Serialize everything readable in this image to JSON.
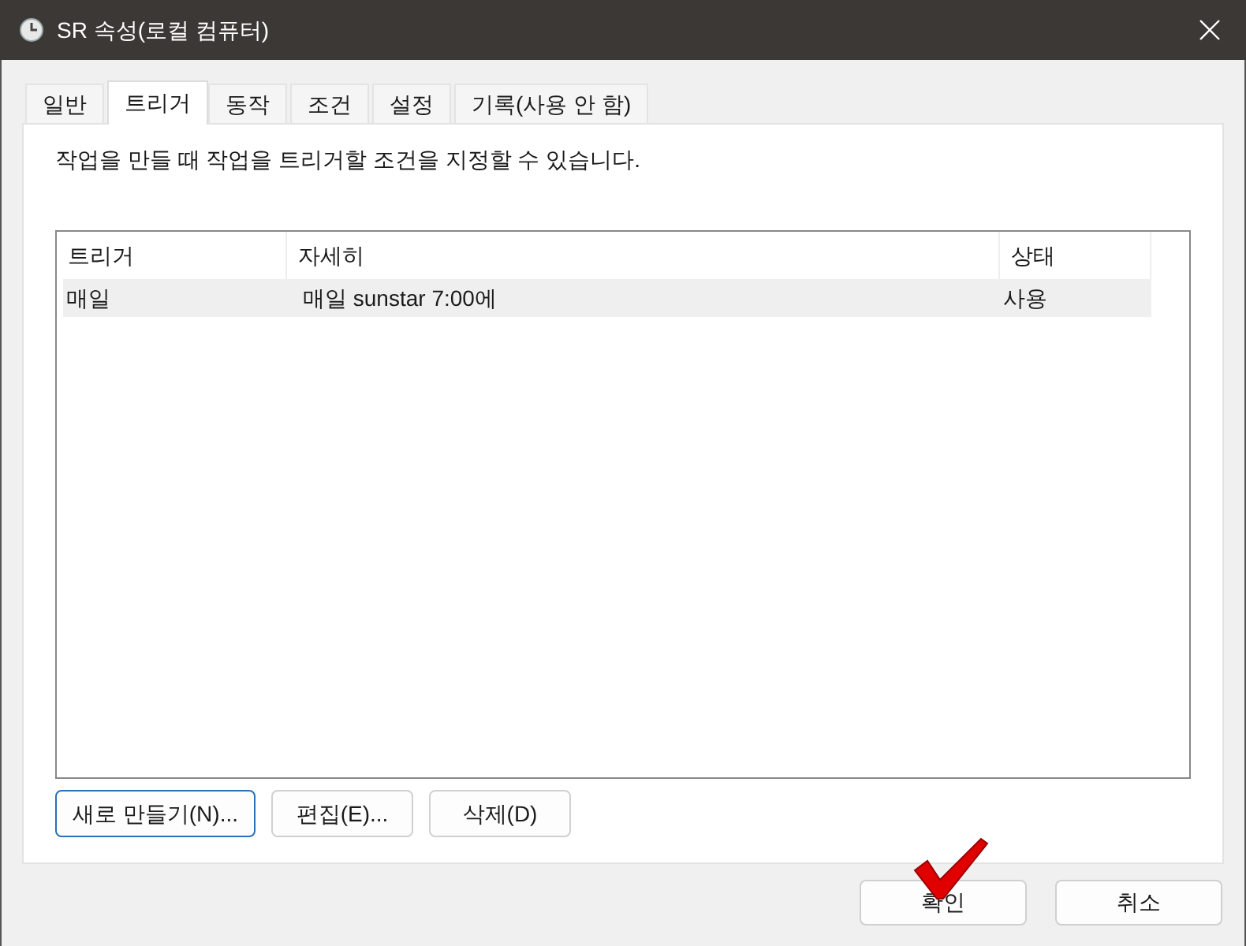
{
  "window": {
    "title": "SR 속성(로컬 컴퓨터)"
  },
  "tabs": [
    {
      "label": "일반",
      "selected": false
    },
    {
      "label": "트리거",
      "selected": true
    },
    {
      "label": "동작",
      "selected": false
    },
    {
      "label": "조건",
      "selected": false
    },
    {
      "label": "설정",
      "selected": false
    },
    {
      "label": "기록(사용 안 함)",
      "selected": false
    }
  ],
  "description": "작업을 만들 때 작업을 트리거할 조건을 지정할 수 있습니다.",
  "table": {
    "columns": [
      "트리거",
      "자세히",
      "상태"
    ],
    "rows": [
      {
        "cells": [
          "매일",
          "매일 sunstar 7:00에",
          "사용"
        ],
        "selected": true
      }
    ]
  },
  "actions": [
    {
      "label": "새로 만들기(N)...",
      "focused": true
    },
    {
      "label": "편집(E)...",
      "focused": false
    },
    {
      "label": "삭제(D)",
      "focused": false
    }
  ],
  "buttons": [
    "확인",
    "취소"
  ]
}
